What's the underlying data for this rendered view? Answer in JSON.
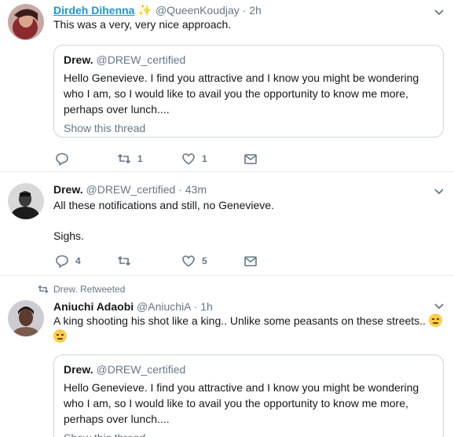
{
  "colors": {
    "link": "#1b95e0",
    "secondary_text": "#657786",
    "border": "#ccd6dd",
    "divider": "#e6ecf0"
  },
  "tweets": [
    {
      "name": "Dirdeh Dihenna",
      "name_suffix_icon": "sparkles-emoji",
      "handle": "@QueenKoudjay",
      "separator": "·",
      "time": "2h",
      "text": "This was a very, very nice approach.",
      "quote": {
        "name": "Drew.",
        "handle": "@DREW_certified",
        "text": "Hello Genevieve. I find you attractive and I know you might be wondering who I am, so I would like to avail you the opportunity to know me more, perhaps over lunch....",
        "show_thread": "Show this thread"
      },
      "actions": {
        "reply": "",
        "retweet": "1",
        "like": "1"
      }
    },
    {
      "name": "Drew.",
      "handle": "@DREW_certified",
      "separator": "·",
      "time": "43m",
      "text_line1": "All these notifications and still, no Genevieve.",
      "text_line2": "Sighs.",
      "actions": {
        "reply": "4",
        "retweet": "",
        "like": "5"
      }
    },
    {
      "retweeted_by": "Drew. Retweeted",
      "name": "Aniuchi Adaobi",
      "handle": "@AniuchiA",
      "separator": "·",
      "time": "1h",
      "text": "A king shooting his shot like a king.. Unlike some peasants on these streets..",
      "text_emoji": "unamused-face-emoji",
      "quote": {
        "name": "Drew.",
        "handle": "@DREW_certified",
        "text": "Hello Genevieve. I find you attractive and I know you might be wondering who I am, so I would like to avail you the opportunity to know me more, perhaps over lunch....",
        "show_thread": "Show this thread"
      }
    }
  ]
}
